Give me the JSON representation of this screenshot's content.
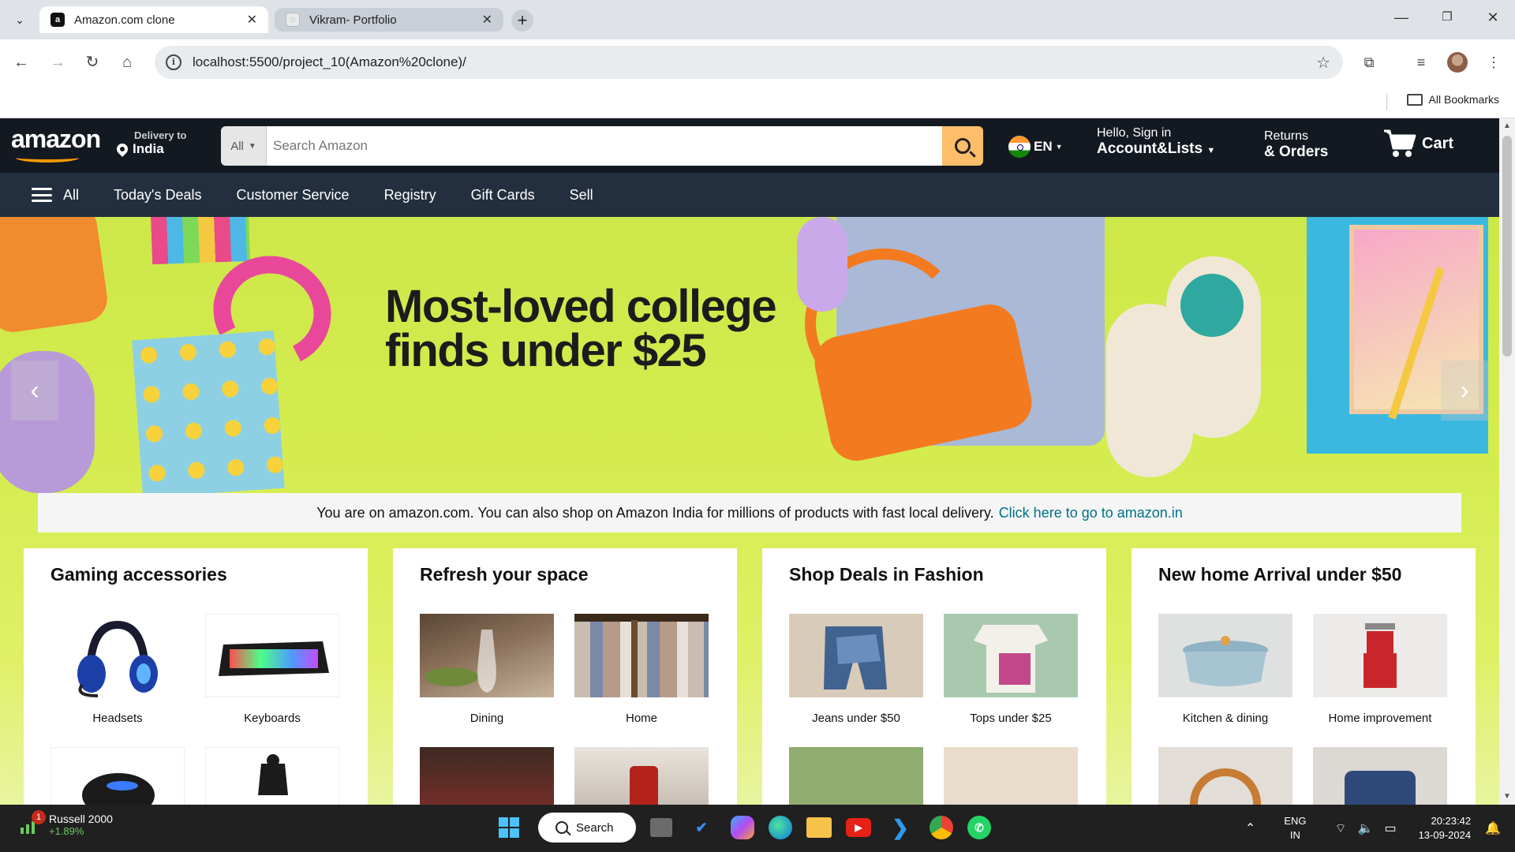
{
  "browser": {
    "tabs": [
      {
        "title": "Amazon.com clone",
        "favicon": "a"
      },
      {
        "title": "Vikram- Portfolio",
        "favicon": "◌"
      }
    ],
    "new_tab_label": "+",
    "url": "localhost:5500/project_10(Amazon%20clone)/",
    "bookmarks_label": "All Bookmarks"
  },
  "header": {
    "logo": "amazon",
    "delivery_small": "Delivery to",
    "delivery_big": "India",
    "search_category": "All",
    "search_placeholder": "Search Amazon",
    "lang": "EN",
    "account_small": "Hello, Sign in",
    "account_big": "Account&Lists",
    "returns_small": "Returns",
    "returns_big": "& Orders",
    "cart": "Cart"
  },
  "subnav": {
    "all": "All",
    "items": [
      "Today's Deals",
      "Customer Service",
      "Registry",
      "Gift Cards",
      "Sell"
    ]
  },
  "hero": {
    "headline_line1": "Most-loved college",
    "headline_line2": "finds under $25",
    "prev": "‹",
    "next": "›",
    "colors": {
      "background": "#d4ec4e",
      "bag": "#f47a1f",
      "shirt": "#a9b9d6"
    }
  },
  "notice": {
    "text": "You are on amazon.com. You can also shop on Amazon India for millions of products with fast local delivery.",
    "link": "Click here to go to amazon.in"
  },
  "cards": [
    {
      "title": "Gaming accessories",
      "tiles": [
        "Headsets",
        "Keyboards"
      ]
    },
    {
      "title": "Refresh your space",
      "tiles": [
        "Dining",
        "Home"
      ]
    },
    {
      "title": "Shop Deals in Fashion",
      "tiles": [
        "Jeans under $50",
        "Tops under $25"
      ]
    },
    {
      "title": "New home Arrival under $50",
      "tiles": [
        "Kitchen & dining",
        "Home improvement"
      ]
    }
  ],
  "taskbar": {
    "ticker_name": "Russell 2000",
    "ticker_value": "+1.89%",
    "ticker_badge": "1",
    "search_label": "Search",
    "lang_line1": "ENG",
    "lang_line2": "IN",
    "time": "20:23:42",
    "date": "13-09-2024"
  }
}
